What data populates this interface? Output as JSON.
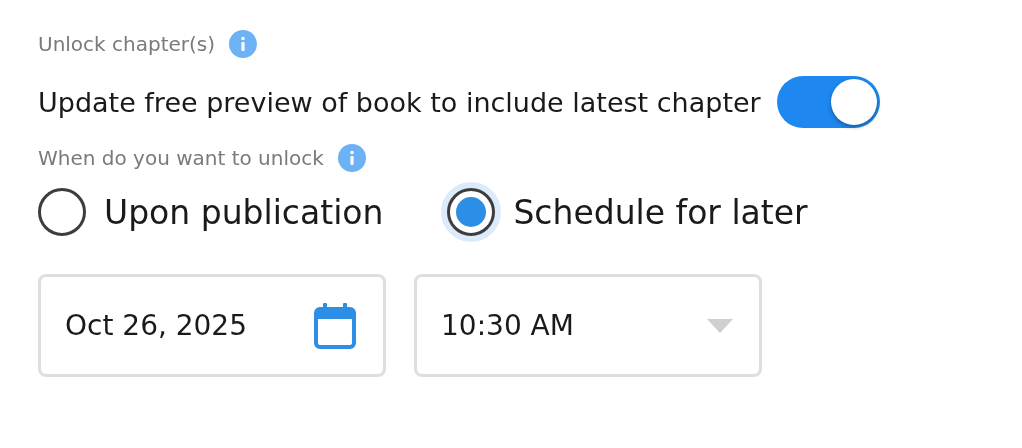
{
  "unlock_label": {
    "text": "Unlock chapter(s)"
  },
  "preview_toggle": {
    "label": "Update free preview of book to include latest chapter",
    "on": true
  },
  "when_label": {
    "text": "When do you want to unlock"
  },
  "options": [
    {
      "label": "Upon publication",
      "selected": false
    },
    {
      "label": "Schedule for later",
      "selected": true
    }
  ],
  "date_field": {
    "value": "Oct 26, 2025"
  },
  "time_field": {
    "value": "10:30 AM"
  }
}
